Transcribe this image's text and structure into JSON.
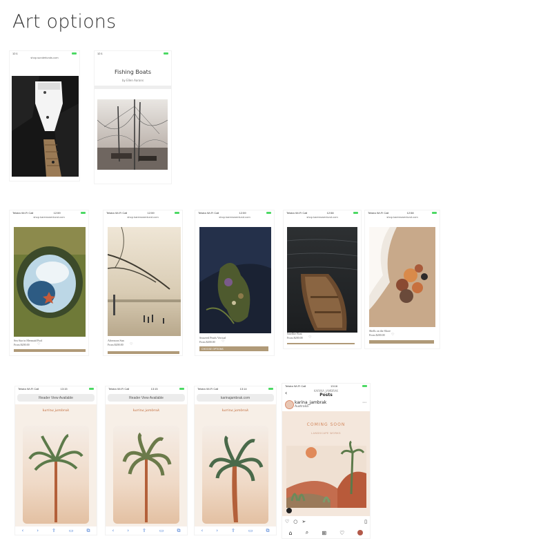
{
  "page": {
    "title": "Art options"
  },
  "row1": {
    "shot1": {
      "time": "12:1",
      "url": "shop.sunderlunds.com"
    },
    "shot2": {
      "time": "12:1",
      "heading": "Fishing Boats",
      "byline": "by Ellen Aarans"
    }
  },
  "row2": [
    {
      "carrier": "Telstra Wi-Fi Call",
      "time": "12:59",
      "url": "shop.karenswenlund.com",
      "caption": "Sea Star in Mermaid Pool",
      "price": "From $200.00"
    },
    {
      "carrier": "Telstra Wi-Fi Call",
      "time": "12:59",
      "url": "shop.karenswenlund.com",
      "caption": "Afternoon Sun",
      "price": "From $200.00"
    },
    {
      "carrier": "Telstra Wi-Fi Call",
      "time": "12:59",
      "url": "shop.karenswenlund.com",
      "caption": "Seaweed Pearls Vertical",
      "price": "From $200.00",
      "button": "CHOOSE OPTIONS"
    },
    {
      "carrier": "Telstra Wi-Fi Call",
      "time": "12:58",
      "url": "shop.karenswenlund.com",
      "caption": "Satellite Boat",
      "price": "From $200.00"
    },
    {
      "carrier": "Telstra Wi-Fi Call",
      "time": "12:58",
      "url": "shop.karenswenlund.com",
      "caption": "Shells on the Shore",
      "price": "From $200.00"
    }
  ],
  "row3": [
    {
      "carrier": "Telstra Wi-Fi Call",
      "time": "13:15",
      "bar_text": "Reader View Available",
      "brand": "karina jambrak"
    },
    {
      "carrier": "Telstra Wi-Fi Call",
      "time": "13:15",
      "bar_text": "Reader View Available",
      "brand": "karina jambrak"
    },
    {
      "carrier": "Telstra Wi-Fi Call",
      "time": "13:14",
      "bar_text": "karinajambrak.com",
      "brand": "karina jambrak"
    }
  ],
  "insta": {
    "carrier": "Telstra Wi-Fi Call",
    "time": "13:16",
    "header_user": "KARINA_JAMBRAK",
    "header_title": "Posts",
    "username": "karina_jambrak",
    "location": "Australia",
    "coming_soon": "COMING SOON",
    "sub": "LANDSCAPE WORKS"
  },
  "colors": {
    "accent": "#b09a78",
    "safari_blue": "#4a7fd6",
    "brand": "#c06a3a"
  }
}
